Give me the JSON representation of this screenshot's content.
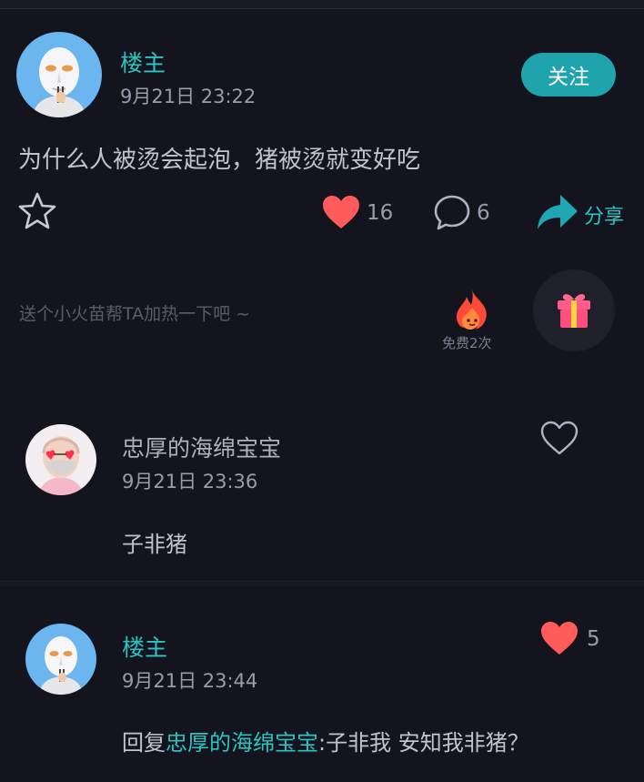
{
  "post": {
    "author": "楼主",
    "time": "9月21日 23:22",
    "follow_label": "关注",
    "text": "为什么人被烫会起泡，猪被烫就变好吃",
    "like_count": "16",
    "comment_count": "6",
    "share_label": "分享"
  },
  "boost": {
    "hint": "送个小火苗帮TA加热一下吧 ~",
    "free_label": "免费2次"
  },
  "comments": [
    {
      "author": "忠厚的海绵宝宝",
      "time": "9月21日 23:36",
      "text": "子非猪",
      "liked": false
    },
    {
      "author": "楼主",
      "time": "9月21日 23:44",
      "reply_prefix": "回复",
      "reply_to": "忠厚的海绵宝宝",
      "text": ":子非我 安知我非猪？",
      "like_count": "5",
      "liked": true
    }
  ],
  "colors": {
    "background": "#14141f",
    "accent_teal": "#2bc4c0",
    "follow_button": "#1fa3ad",
    "heart_red": "#ff5b5b"
  },
  "icons": {
    "favorite": "star-outline-icon",
    "like": "heart-icon",
    "comment": "comment-bubble-icon",
    "share": "share-arrow-icon",
    "fire": "fire-icon",
    "gift": "gift-icon"
  }
}
